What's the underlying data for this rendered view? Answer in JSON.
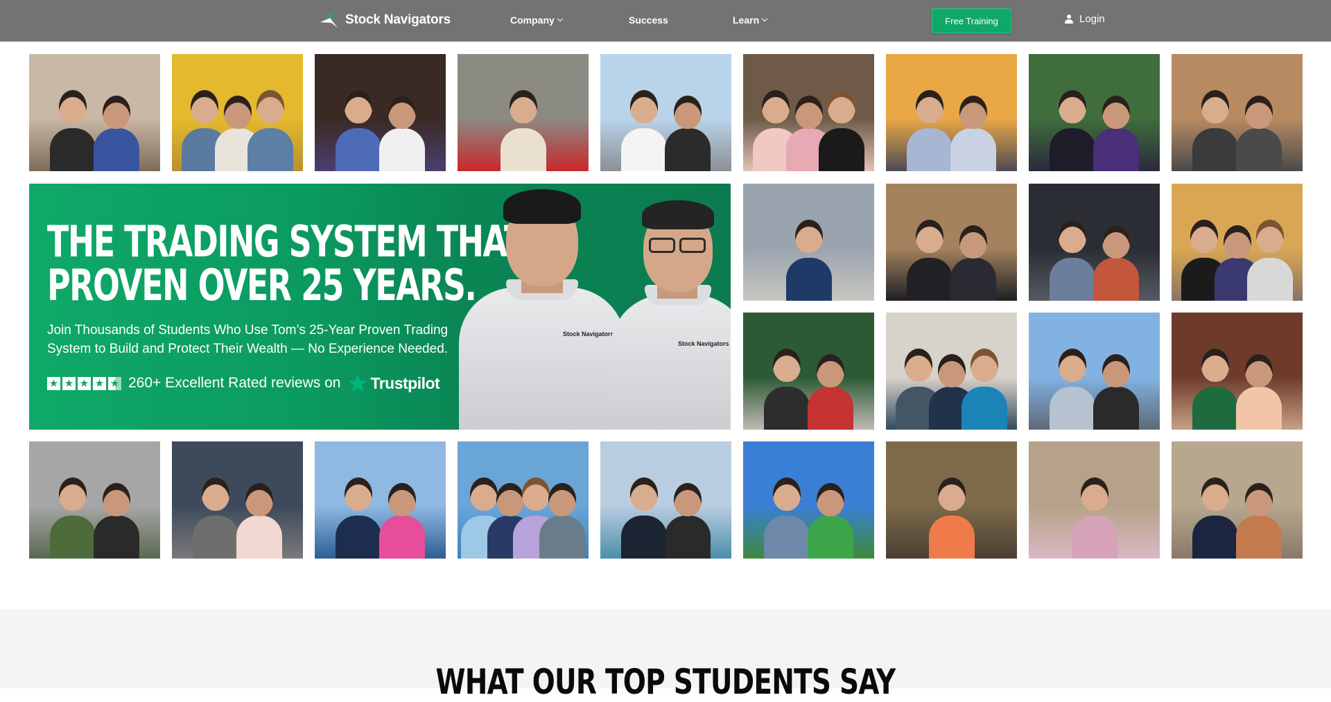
{
  "header": {
    "brand": "Stock Navigators",
    "nav": [
      {
        "label": "Company",
        "dropdown": true
      },
      {
        "label": "Success",
        "dropdown": false
      },
      {
        "label": "Learn",
        "dropdown": true
      },
      {
        "label": "",
        "dropdown": false,
        "active": true
      }
    ],
    "cta_label": "Free Training",
    "login_label": "Login",
    "colors": {
      "bar": "#737373",
      "accent": "#10a86a"
    }
  },
  "banner": {
    "title_line1": "THE TRADING SYSTEM THAT’S",
    "title_line2": "PROVEN OVER 25 YEARS.",
    "subtitle": "Join Thousands of Students Who Use Tom’s 25-Year Proven Trading System to Build and Protect Their Wealth — No Experience Needed.",
    "rating_text": "260+ Excellent Rated reviews on",
    "trustpilot_label": "Trustpilot",
    "stars": 4.5,
    "shirt_badge": "Stock Navigators"
  },
  "photos": [
    {
      "name": "photo-couple-1",
      "bg": "#c9b8a6",
      "ground": "#7f6a58",
      "faces": 2,
      "shirts": [
        "#2a2a2a",
        "#3a55a0"
      ]
    },
    {
      "name": "photo-family-sunflowers",
      "bg": "#e4b92d",
      "ground": "#b9912f",
      "faces": 3,
      "shirts": [
        "#5b7aa0",
        "#e8e4dc",
        "#5e7fa5"
      ]
    },
    {
      "name": "photo-family-night",
      "bg": "#3a2a25",
      "ground": "#4a3f6e",
      "faces": 2,
      "shirts": [
        "#4e6bb8",
        "#f0f0f0"
      ]
    },
    {
      "name": "photo-man-red-car",
      "bg": "#8b8a83",
      "ground": "#c8282c",
      "faces": 1,
      "shirts": [
        "#eae0cf"
      ]
    },
    {
      "name": "photo-couple-marina",
      "bg": "#b9d4ea",
      "ground": "#8b8f93",
      "faces": 2,
      "shirts": [
        "#f4f4f4",
        "#2b2b2b"
      ]
    },
    {
      "name": "photo-family-porch",
      "bg": "#6f5a48",
      "ground": "#e2c2b6",
      "faces": 3,
      "shirts": [
        "#f1c8c4",
        "#e7a9b4",
        "#1a1a1a"
      ]
    },
    {
      "name": "photo-father-son-sunset",
      "bg": "#e9a746",
      "ground": "#4d4b54",
      "faces": 2,
      "shirts": [
        "#a7b6d3",
        "#c8d2e2"
      ]
    },
    {
      "name": "photo-graduation",
      "bg": "#3f6d3b",
      "ground": "#2b2a3f",
      "faces": 2,
      "shirts": [
        "#1d1d2a",
        "#4b2e7a"
      ]
    },
    {
      "name": "photo-couple-restaurant",
      "bg": "#b88a62",
      "ground": "#4a4a4a",
      "faces": 2,
      "shirts": [
        "#3b3b3b",
        "#4a4a4a"
      ]
    },
    {
      "name": "photo-man-mountain",
      "bg": "#9aa4ae",
      "ground": "#c9c6c1",
      "faces": 1,
      "shirts": [
        "#1f3a68"
      ]
    },
    {
      "name": "photo-father-daughter",
      "bg": "#a4825e",
      "ground": "#1f1f22",
      "faces": 2,
      "shirts": [
        "#222226",
        "#2a2a32"
      ]
    },
    {
      "name": "photo-boy-trading-desk",
      "bg": "#2a2d33",
      "ground": "#555a62",
      "faces": 2,
      "shirts": [
        "#6b7f9c",
        "#c4563b"
      ]
    },
    {
      "name": "photo-family-gold",
      "bg": "#d9a754",
      "ground": "#8a7263",
      "faces": 3,
      "shirts": [
        "#1b1b1b",
        "#3a3a70",
        "#d8d8d8"
      ]
    },
    {
      "name": "photo-family-hike",
      "bg": "#2c5a35",
      "ground": "#bfbab2",
      "faces": 2,
      "shirts": [
        "#2d2d2d",
        "#c43232"
      ]
    },
    {
      "name": "photo-family-restaurant-wall",
      "bg": "#d7d3cb",
      "ground": "#334b5f",
      "faces": 3,
      "shirts": [
        "#445566",
        "#22324a",
        "#1b84b6"
      ]
    },
    {
      "name": "photo-couple-selfie-sky",
      "bg": "#82b2e2",
      "ground": "#5d6a78",
      "faces": 2,
      "shirts": [
        "#b6c2cf",
        "#2a2a2a"
      ]
    },
    {
      "name": "photo-sisters-dinner",
      "bg": "#6e3a2a",
      "ground": "#c7a085",
      "faces": 2,
      "shirts": [
        "#1f6b40",
        "#f2c4a8"
      ]
    },
    {
      "name": "photo-couple-lake",
      "bg": "#a6a6a6",
      "ground": "#5a6a4f",
      "faces": 2,
      "shirts": [
        "#4d6b3b",
        "#2a2a2a"
      ]
    },
    {
      "name": "photo-father-baby-desk",
      "bg": "#3d4a5c",
      "ground": "#7a7a7a",
      "faces": 2,
      "shirts": [
        "#6e6e6e",
        "#f0d8d0"
      ]
    },
    {
      "name": "photo-couple-ocean",
      "bg": "#8fb8e3",
      "ground": "#2d5f93",
      "faces": 2,
      "shirts": [
        "#1c2d4e",
        "#e84d9a"
      ]
    },
    {
      "name": "photo-family-pool",
      "bg": "#6aa5d8",
      "ground": "#3b83b8",
      "faces": 4,
      "shirts": [
        "#9dc8e6",
        "#2a3a66",
        "#b7a3d9",
        "#6a7c8b"
      ]
    },
    {
      "name": "photo-couple-cruise",
      "bg": "#b8cde0",
      "ground": "#4c8eaa",
      "faces": 2,
      "shirts": [
        "#1a2433",
        "#2a2a2a"
      ]
    },
    {
      "name": "photo-father-son-golf",
      "bg": "#3a7fd6",
      "ground": "#3d8a3a",
      "faces": 2,
      "shirts": [
        "#6d88a8",
        "#3ea64a"
      ]
    },
    {
      "name": "photo-man-alligator",
      "bg": "#7c6a4a",
      "ground": "#4a3f33",
      "faces": 1,
      "shirts": [
        "#f07b4a"
      ]
    },
    {
      "name": "photo-woman-market",
      "bg": "#b6a28a",
      "ground": "#d9b8c4",
      "faces": 1,
      "shirts": [
        "#d6a3b8"
      ]
    },
    {
      "name": "photo-couple-selfie-city",
      "bg": "#b7a78e",
      "ground": "#8a7868",
      "faces": 2,
      "shirts": [
        "#1b2540",
        "#c27a4e"
      ]
    }
  ],
  "testimonials": {
    "title": "WHAT OUR TOP STUDENTS SAY"
  }
}
